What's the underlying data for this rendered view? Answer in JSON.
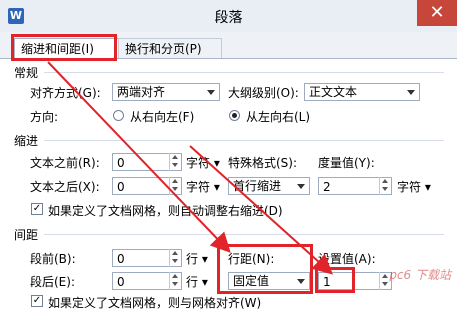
{
  "window": {
    "title": "段落",
    "close_glyph": "✕",
    "app_icon": "W"
  },
  "tabs": [
    {
      "label": "缩进和间距(I)",
      "active": true
    },
    {
      "label": "换行和分页(P)",
      "active": false
    }
  ],
  "general": {
    "section_title": "常规",
    "alignment_label": "对齐方式(G):",
    "alignment_value": "两端对齐",
    "outline_label": "大纲级别(O):",
    "outline_value": "正文文本",
    "direction_label": "方向:",
    "rtl_label": "从右向左(F)",
    "ltr_label": "从左向右(L)",
    "ltr_selected": true
  },
  "indent": {
    "section_title": "缩进",
    "before_label": "文本之前(R):",
    "before_value": "0",
    "before_unit": "字符",
    "after_label": "文本之后(X):",
    "after_value": "0",
    "after_unit": "字符",
    "special_label": "特殊格式(S):",
    "special_value": "首行缩进",
    "measure_label": "度量值(Y):",
    "measure_value": "2",
    "measure_unit": "字符",
    "grid_checkbox_label": "如果定义了文档网格，则自动调整右缩进(D)",
    "grid_checked": true
  },
  "spacing": {
    "section_title": "间距",
    "before_label": "段前(B):",
    "before_value": "0",
    "before_unit": "行",
    "after_label": "段后(E):",
    "after_value": "0",
    "after_unit": "行",
    "line_label": "行距(N):",
    "line_value": "固定值",
    "setting_label": "设置值(A):",
    "setting_value": "1",
    "grid_checkbox_label": "如果定义了文档网格，则与网格对齐(W)",
    "grid_checked": true
  },
  "watermark": {
    "text": "pc6 下载站"
  },
  "annotation_color": "#e0242a"
}
